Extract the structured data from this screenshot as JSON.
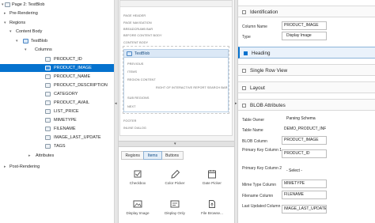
{
  "tree": {
    "page": "Page 2: TestBlob",
    "pre_rendering": "Pre-Rendering",
    "regions": "Regions",
    "content_body": "Content Body",
    "region": "TestBlob",
    "columns": "Columns",
    "column_items": [
      "PRODUCT_ID",
      "PRODUCT_IMAGE",
      "PRODUCT_NAME",
      "PRODUCT_DESCRIPTION",
      "CATEGORY",
      "PRODUCT_AVAIL",
      "LIST_PRICE",
      "MIMETYPE",
      "FILENAME",
      "IMAGE_LAST_UPDATE",
      "TAGS"
    ],
    "selected_column": "PRODUCT_IMAGE",
    "attributes": "Attributes",
    "post_rendering": "Post-Rendering"
  },
  "layout": {
    "slots_top": [
      "PAGE HEADER",
      "PAGE NAVIGATION",
      "BREADCRUMB BAR",
      "BEFORE CONTENT BODY",
      "CONTENT BODY"
    ],
    "region_title": "TestBlob",
    "region_slots": [
      "PREVIOUS",
      "ITEMS",
      "REGION CONTENT",
      "RIGHT OF INTERACTIVE REPORT SEARCH BAR",
      "SUB REGIONS",
      "NEXT"
    ],
    "slots_bottom": [
      "FOOTER",
      "INLINE DIALOG"
    ]
  },
  "gallery": {
    "tabs": [
      "Regions",
      "Items",
      "Buttons"
    ],
    "active_tab": "Items",
    "items": [
      {
        "label": "Checkbox",
        "icon": "checkbox-icon"
      },
      {
        "label": "Color Picker",
        "icon": "color-picker-icon"
      },
      {
        "label": "Date Picker",
        "icon": "date-picker-icon"
      },
      {
        "label": "Display Image",
        "icon": "display-image-icon"
      },
      {
        "label": "Display Only",
        "icon": "display-only-icon"
      },
      {
        "label": "File Browse...",
        "icon": "file-browse-icon"
      }
    ]
  },
  "properties": {
    "identification": "Identification",
    "column_name_label": "Column Name",
    "column_name": "PRODUCT_IMAGE",
    "type_label": "Type",
    "type": "Display Image",
    "heading": "Heading",
    "single_row_view": "Single Row View",
    "layout": "Layout",
    "blob_attributes": "BLOB Attributes",
    "table_owner_label": "Table Owner",
    "table_owner": "Parsing Schema",
    "table_name_label": "Table Name",
    "table_name": "DEMO_PRODUCT_INFO",
    "blob_column_label": "BLOB Column",
    "blob_column": "PRODUCT_IMAGE",
    "pk1_label": "Primary Key Column 1",
    "pk1": "PRODUCT_ID",
    "pk2_label": "Primary Key Column 2",
    "pk2": "- Select -",
    "mime_label": "Mime Type Column",
    "mime": "MIMETYPE",
    "filename_label": "Filename Column",
    "filename": "FILENAME",
    "last_updated_label": "Last Updated Column",
    "last_updated": "IMAGE_LAST_UPDATE"
  },
  "colors": {
    "accent": "#0572ce",
    "selection_text": "#ffffff"
  }
}
